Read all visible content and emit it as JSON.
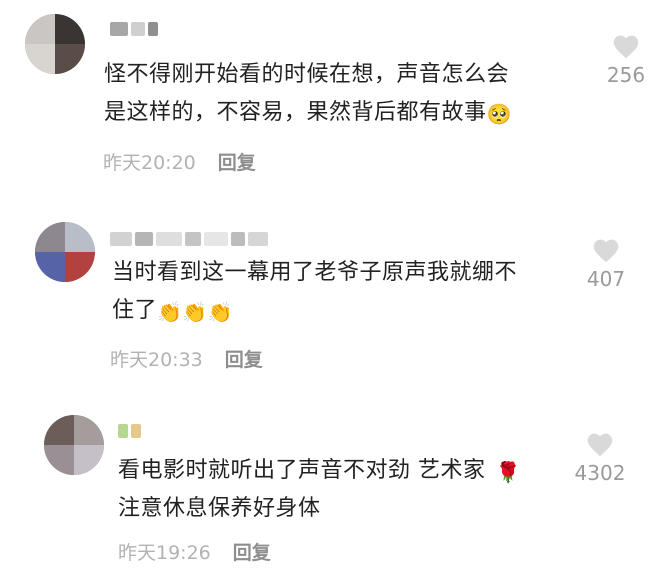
{
  "comments": [
    {
      "text_line1": "怪不得刚开始看的时候在想，声音怎么会",
      "text_line2": "是这样的，不容易，果然背后都有故事",
      "emoji": "🥺",
      "time": "昨天20:20",
      "reply_label": "回复",
      "likes": "256",
      "like_icon": "heart-icon"
    },
    {
      "text_line1": "当时看到这一幕用了老爷子原声我就绷不",
      "text_line2": "住了",
      "emoji": "👏👏👏",
      "time": "昨天20:33",
      "reply_label": "回复",
      "likes": "407",
      "like_icon": "heart-icon"
    },
    {
      "text_line1": "看电影时就听出了声音不对劲 艺术家",
      "text_line2": "注意休息保养好身体",
      "emoji": "🌹",
      "time": "昨天19:26",
      "reply_label": "回复",
      "likes": "4302",
      "like_icon": "heart-icon"
    }
  ],
  "colors": {
    "text": "#222222",
    "meta": "#b2b2b2",
    "reply": "#8e8e8e",
    "heart": "#d9d9d9"
  }
}
